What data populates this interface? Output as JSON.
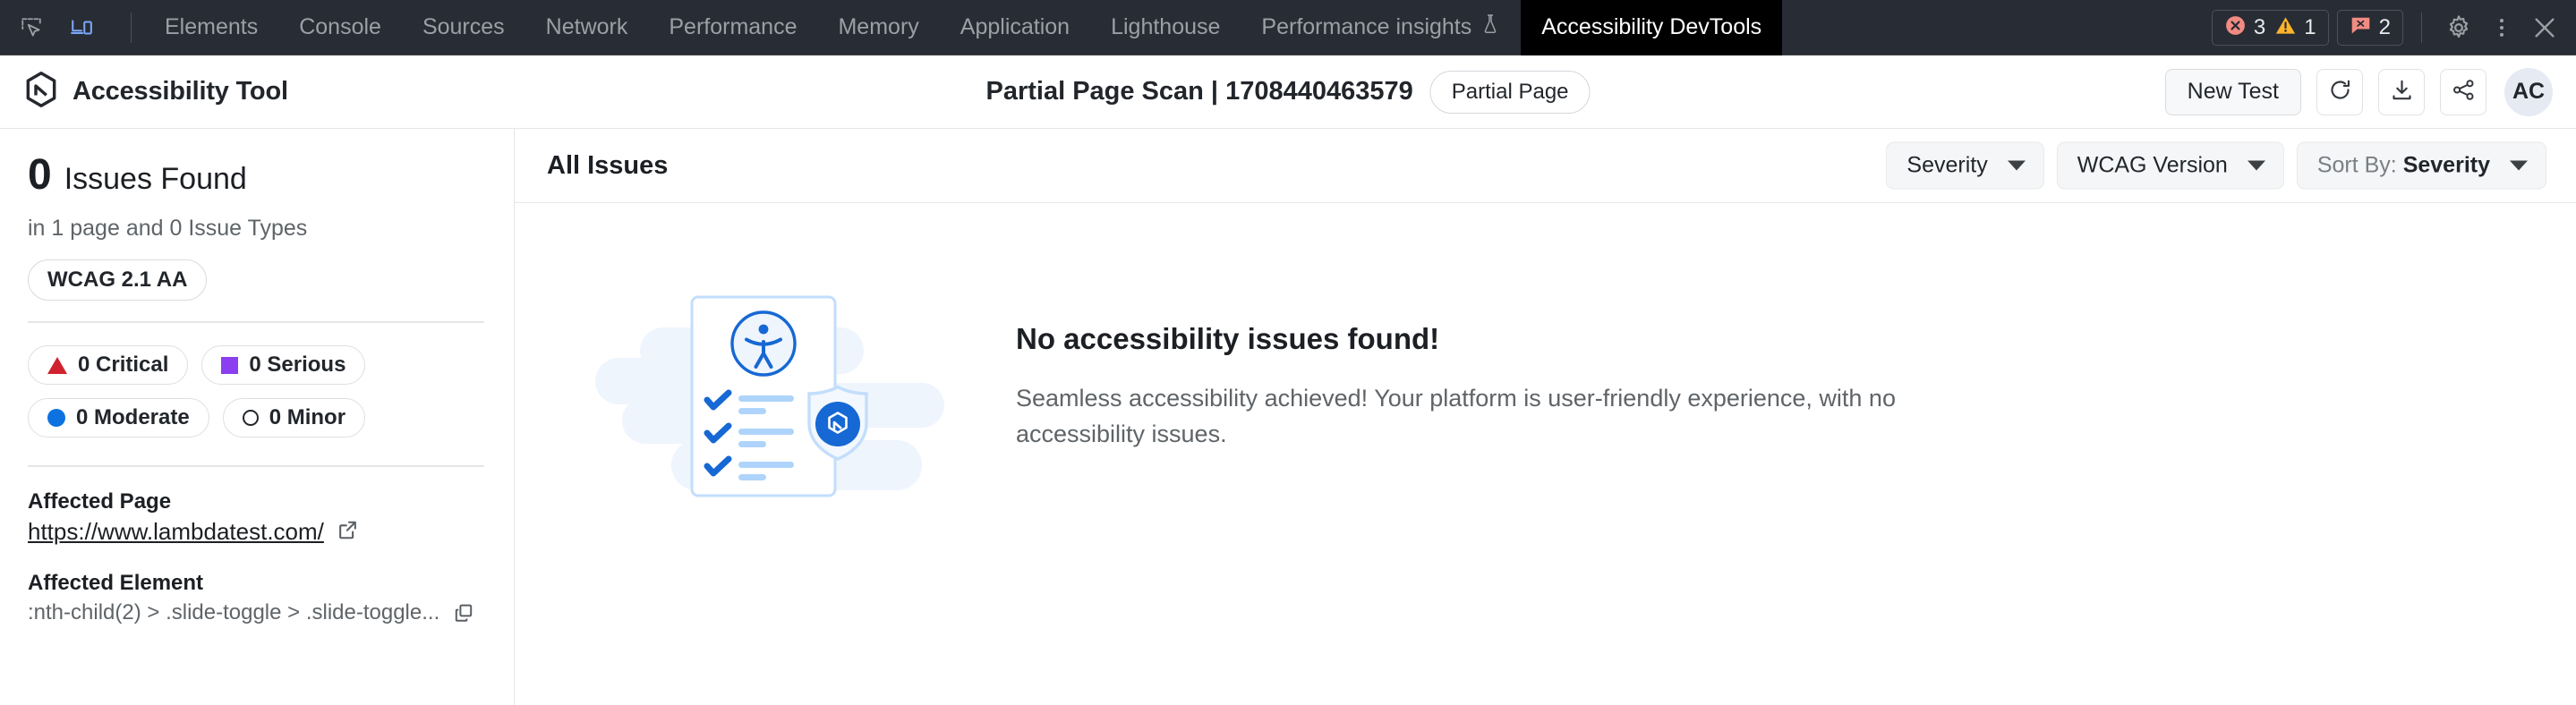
{
  "devtools": {
    "left_icons": [
      {
        "name": "inspect-element-icon",
        "active": false
      },
      {
        "name": "device-toolbar-icon",
        "active": true
      }
    ],
    "tabs": [
      {
        "label": "Elements",
        "active": false,
        "icon": ""
      },
      {
        "label": "Console",
        "active": false,
        "icon": ""
      },
      {
        "label": "Sources",
        "active": false,
        "icon": ""
      },
      {
        "label": "Network",
        "active": false,
        "icon": ""
      },
      {
        "label": "Performance",
        "active": false,
        "icon": ""
      },
      {
        "label": "Memory",
        "active": false,
        "icon": ""
      },
      {
        "label": "Application",
        "active": false,
        "icon": ""
      },
      {
        "label": "Lighthouse",
        "active": false,
        "icon": ""
      },
      {
        "label": "Performance insights",
        "active": false,
        "icon": "flask-icon"
      },
      {
        "label": "Accessibility DevTools",
        "active": true,
        "icon": ""
      }
    ],
    "status": {
      "error_count": "3",
      "warning_count": "1",
      "message_count": "2",
      "error_color": "#f28b82",
      "warning_color": "#fdd663",
      "message_color": "#f28b82"
    },
    "right_icons": [
      {
        "name": "settings-gear-icon"
      },
      {
        "name": "more-options-icon"
      },
      {
        "name": "close-devtools-icon"
      }
    ]
  },
  "header": {
    "brand": "Accessibility Tool",
    "brand_logo": "lambdatest-hex-arrow-logo",
    "scan_title": "Partial Page Scan | 1708440463579",
    "scan_badge": "Partial Page",
    "new_test_label": "New Test",
    "actions": [
      {
        "name": "refresh-button",
        "icon": "refresh-icon"
      },
      {
        "name": "download-button",
        "icon": "download-icon"
      },
      {
        "name": "share-button",
        "icon": "share-icon"
      }
    ],
    "avatar_initials": "AC"
  },
  "sidebar": {
    "issues_count": "0",
    "issues_label": "Issues Found",
    "issues_sub": "in 1 page and 0 Issue Types",
    "wcag_pill": "WCAG 2.1 AA",
    "severity_chips": [
      {
        "label": "0 Critical",
        "marker": "triangle",
        "color": "#d0222f"
      },
      {
        "label": "0 Serious",
        "marker": "square",
        "color": "#8b3ff0"
      },
      {
        "label": "0 Moderate",
        "marker": "circle",
        "color": "#0c72e0"
      },
      {
        "label": "0 Minor",
        "marker": "ring",
        "color": "#22262b"
      }
    ],
    "affected_page_label": "Affected Page",
    "affected_page_url": "https://www.lambdatest.com/",
    "external_link_icon": "external-link-icon",
    "affected_element_label": "Affected Element",
    "affected_element_selector": ":nth-child(2) > .slide-toggle > .slide-toggle...",
    "copy_icon": "copy-icon"
  },
  "main": {
    "title": "All Issues",
    "filters": [
      {
        "label": "Severity",
        "prefix": "",
        "name": "severity-filter"
      },
      {
        "label": "WCAG Version",
        "prefix": "",
        "name": "wcag-version-filter"
      },
      {
        "label": "Severity",
        "prefix": "Sort By:",
        "name": "sort-by-filter"
      }
    ],
    "empty_state": {
      "illustration": "accessibility-report-shield-illustration",
      "title": "No accessibility issues found!",
      "description": "Seamless accessibility achieved! Your platform is user-friendly experience, with no accessibility issues."
    }
  },
  "colors": {
    "devtools_bg": "#282c34",
    "active_tab_bg": "#000000",
    "brand_blue": "#0c72e0",
    "illustration_light": "#c2defc",
    "illustration_pale": "#eff5fd"
  }
}
